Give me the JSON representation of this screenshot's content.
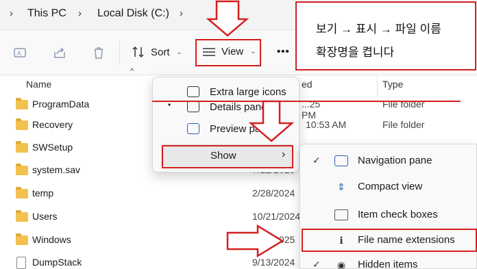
{
  "breadcrumb": {
    "items": [
      "This PC",
      "Local Disk (C:)"
    ]
  },
  "toolbar": {
    "sort_label": "Sort",
    "view_label": "View",
    "more_label": "•••"
  },
  "columns": {
    "name": "Name",
    "date": "ed",
    "type": "Type"
  },
  "files": [
    {
      "name": "ProgramData",
      "date": "...25 PM",
      "type": "File folder",
      "kind": "folder"
    },
    {
      "name": "Recovery",
      "date": "10:53 AM",
      "type": "File folder",
      "kind": "folder"
    },
    {
      "name": "SWSetup",
      "date": "",
      "type": "",
      "kind": "folder"
    },
    {
      "name": "system.sav",
      "date": "7/22/2025",
      "type": "",
      "kind": "folder"
    },
    {
      "name": "temp",
      "date": "2/28/2024",
      "type": "",
      "kind": "folder"
    },
    {
      "name": "Users",
      "date": "10/21/2024",
      "type": "",
      "kind": "folder"
    },
    {
      "name": "Windows",
      "date": "7/12/2025",
      "type": "",
      "kind": "folder"
    },
    {
      "name": "DumpStack",
      "date": "9/13/2024",
      "type": "",
      "kind": "file"
    }
  ],
  "view_menu": {
    "items": [
      "Extra large icons",
      "Details pane",
      "Preview pane"
    ],
    "show_label": "Show",
    "show_arrow": "›"
  },
  "show_menu": {
    "items": [
      {
        "label": "Navigation pane",
        "checked": true
      },
      {
        "label": "Compact view",
        "checked": false
      },
      {
        "label": "Item check boxes",
        "checked": false
      },
      {
        "label": "File name extensions",
        "checked": false
      },
      {
        "label": "Hidden items",
        "checked": true
      }
    ]
  },
  "callout": {
    "line1": "보기 → 표시 → 파일 이름",
    "line2": "확장명을 켭니다"
  },
  "colors": {
    "annotation_red": "#d61f1f",
    "folder_yellow": "#f2c14e",
    "accent_blue": "#2b5fb3"
  }
}
